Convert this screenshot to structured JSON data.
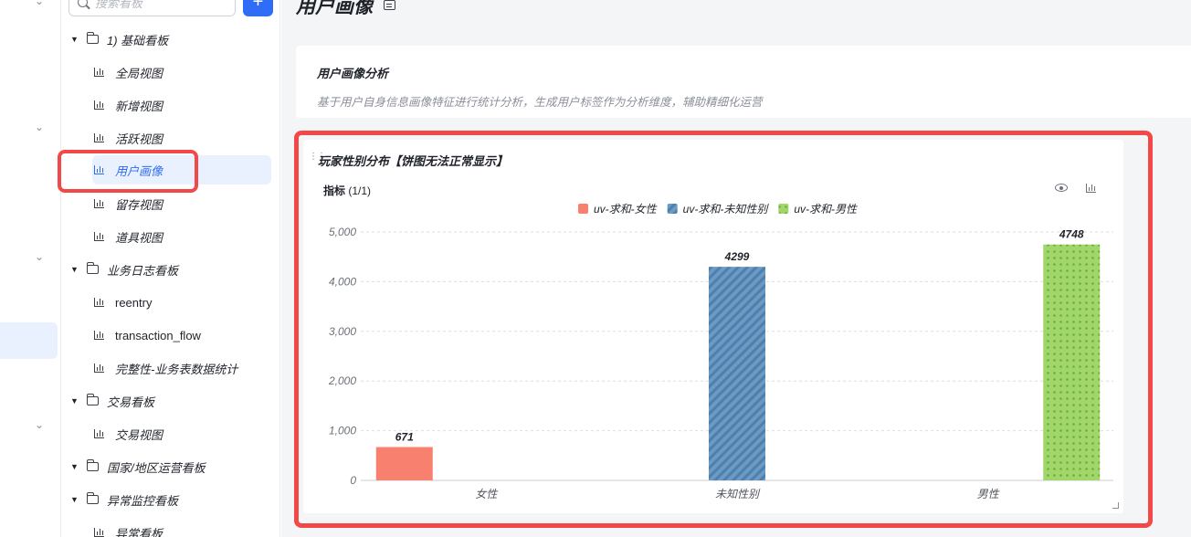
{
  "search": {
    "placeholder": "搜索看板"
  },
  "add_button": "+",
  "tree": {
    "folder1": "1) 基础看板",
    "leaf_all": "全局视图",
    "leaf_new": "新增视图",
    "leaf_active": "活跃视图",
    "leaf_profile": "用户画像",
    "leaf_retention": "留存视图",
    "leaf_items": "道具视图",
    "folder2": "业务日志看板",
    "leaf_reentry": "reentry",
    "leaf_txflow": "transaction_flow",
    "leaf_integrity": "完整性-业务表数据统计",
    "folder3": "交易看板",
    "leaf_trade": "交易视图",
    "folder4": "国家/地区运营看板",
    "folder5": "异常监控看板",
    "leaf_anomaly": "异常看板"
  },
  "page": {
    "title": "用户画像",
    "desc_title": "用户画像分析",
    "desc_text": "基于用户自身信息画像特征进行统计分析，生成用户标签作为分析维度，辅助精细化运营"
  },
  "widget": {
    "title": "玩家性别分布【饼图无法正常显示】",
    "metric_label": "指标",
    "metric_count": "(1/1)"
  },
  "chart_data": {
    "type": "bar",
    "categories": [
      "女性",
      "未知性别",
      "男性"
    ],
    "series": [
      {
        "name": "uv-求和-女性",
        "values": [
          671,
          null,
          null
        ],
        "color": "#f8806f",
        "pattern": "solid"
      },
      {
        "name": "uv-求和-未知性别",
        "values": [
          null,
          4299,
          null
        ],
        "color": "#6b9ac4",
        "pattern": "diagonal-stripes"
      },
      {
        "name": "uv-求和-男性",
        "values": [
          null,
          null,
          4748
        ],
        "color": "#a0d66a",
        "pattern": "dots"
      }
    ],
    "data_labels": [
      "671",
      "4299",
      "4748"
    ],
    "y_ticks": [
      "0",
      "1,000",
      "2,000",
      "3,000",
      "4,000",
      "5,000"
    ],
    "ylim": [
      0,
      5000
    ],
    "grid": true,
    "legend": "top-center"
  }
}
